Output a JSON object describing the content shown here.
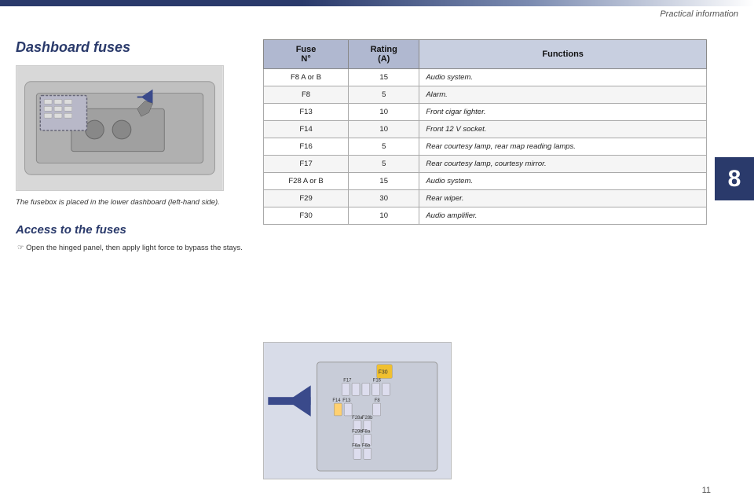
{
  "page": {
    "header_title": "Practical information",
    "page_number": "11",
    "chapter_number": "8",
    "top_bar_color": "#2a3a6b"
  },
  "left_section": {
    "title": "Dashboard fuses",
    "caption": "The fusebox is placed in the lower dashboard\n(left-hand side).",
    "access_title": "Access to the fuses",
    "access_instruction": "Open the hinged panel, then apply light\nforce to bypass the stays."
  },
  "table": {
    "columns": [
      "Fuse\nN°",
      "Rating\n(A)",
      "Functions"
    ],
    "rows": [
      {
        "fuse": "F8 A or B",
        "rating": "15",
        "function": "Audio system."
      },
      {
        "fuse": "F8",
        "rating": "5",
        "function": "Alarm."
      },
      {
        "fuse": "F13",
        "rating": "10",
        "function": "Front cigar lighter."
      },
      {
        "fuse": "F14",
        "rating": "10",
        "function": "Front 12 V socket."
      },
      {
        "fuse": "F16",
        "rating": "5",
        "function": "Rear courtesy lamp, rear map reading lamps."
      },
      {
        "fuse": "F17",
        "rating": "5",
        "function": "Rear courtesy lamp, courtesy mirror."
      },
      {
        "fuse": "F28 A or B",
        "rating": "15",
        "function": "Audio system."
      },
      {
        "fuse": "F29",
        "rating": "30",
        "function": "Rear wiper."
      },
      {
        "fuse": "F30",
        "rating": "10",
        "function": "Audio amplifier."
      }
    ]
  }
}
